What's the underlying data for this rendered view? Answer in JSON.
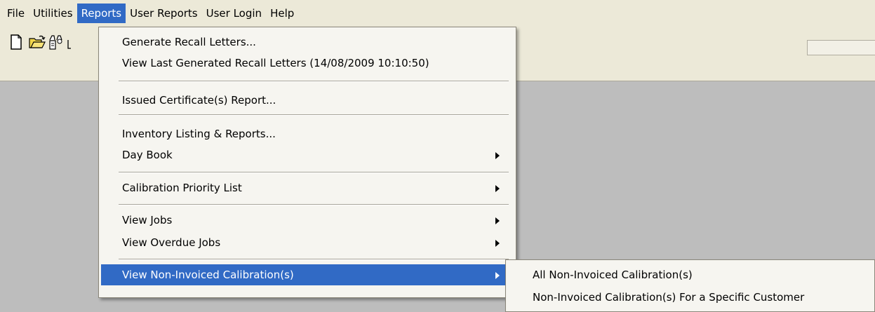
{
  "menubar": {
    "items": [
      {
        "label": "File"
      },
      {
        "label": "Utilities"
      },
      {
        "label": "Reports"
      },
      {
        "label": "User Reports"
      },
      {
        "label": "User Login"
      },
      {
        "label": "Help"
      }
    ],
    "active_item": "Reports"
  },
  "toolbar": {
    "buttons": [
      "new-document-icon",
      "open-folder-icon",
      "binoculars-icon",
      "partial-icon"
    ]
  },
  "reports_menu": {
    "items": [
      {
        "label": "Generate Recall Letters...",
        "submenu": false
      },
      {
        "label": "View Last Generated Recall Letters (14/08/2009 10:10:50)",
        "submenu": false
      },
      {
        "label": "Issued Certificate(s) Report...",
        "submenu": false
      },
      {
        "label": "Inventory Listing & Reports...",
        "submenu": false
      },
      {
        "label": "Day Book",
        "submenu": true
      },
      {
        "label": "Calibration Priority List",
        "submenu": true
      },
      {
        "label": "View Jobs",
        "submenu": true
      },
      {
        "label": "View Overdue Jobs",
        "submenu": true
      },
      {
        "label": "View Non-Invoiced Calibration(s)",
        "submenu": true,
        "selected": true
      }
    ]
  },
  "submenu": {
    "items": [
      {
        "label": "All Non-Invoiced Calibration(s)"
      },
      {
        "label": "Non-Invoiced Calibration(s) For a Specific Customer"
      }
    ]
  },
  "colors": {
    "menubar_bg": "#ece9d8",
    "highlight": "#316ac5",
    "workspace": "#bdbdbd",
    "menu_bg": "#f6f5f0"
  }
}
